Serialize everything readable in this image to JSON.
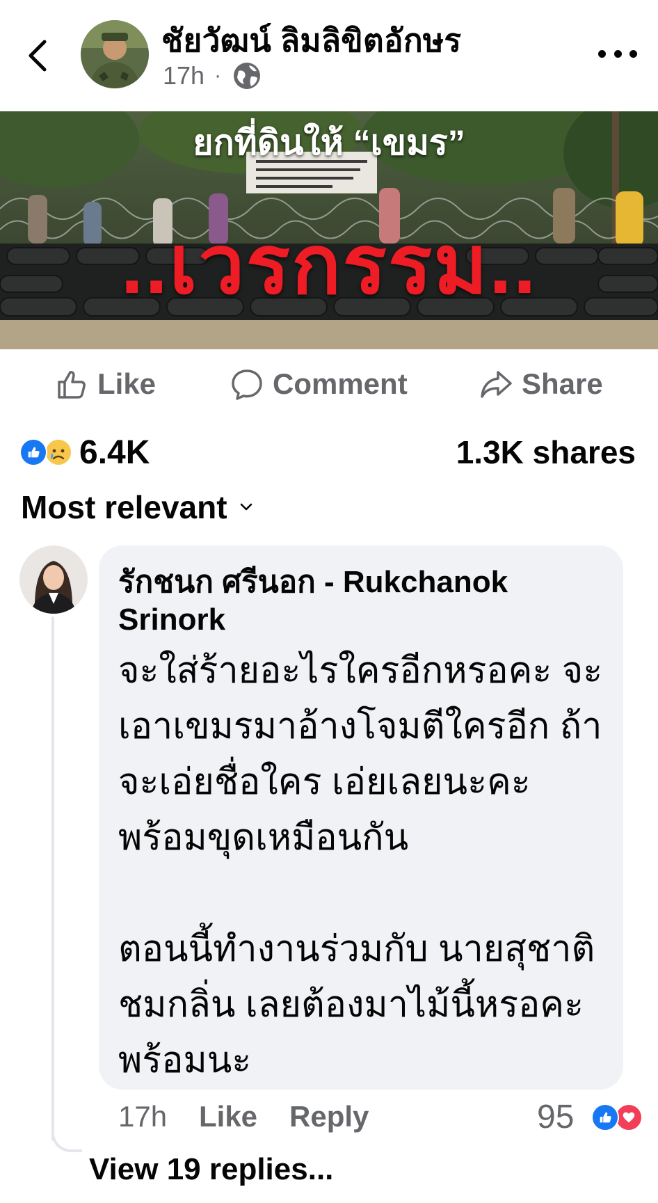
{
  "header": {
    "back_icon": "chevron-left-icon",
    "author_name": "ชัยวัฒน์ ลิมลิขิตอักษร",
    "time": "17h",
    "separator": "·",
    "privacy_icon": "globe-icon",
    "more_icon": "more-horizontal-icon"
  },
  "post_image": {
    "headline_top": "ยกที่ดินให้ “เขมร”",
    "headline_main": "..เวรกรรม..",
    "headline_main_color": "#ee1c24"
  },
  "actions": {
    "like_label": "Like",
    "comment_label": "Comment",
    "share_label": "Share"
  },
  "stats": {
    "reaction_icons": [
      "like-reaction-icon",
      "sad-reaction-icon"
    ],
    "reaction_count": "6.4K",
    "shares": "1.3K shares"
  },
  "sort": {
    "label": "Most relevant"
  },
  "comment": {
    "author": "รักชนก ศรีนอก - Rukchanok Srinork",
    "body": "จะใส่ร้ายอะไรใครอีกหรอคะ จะเอาเขมรมาอ้างโจมตีใครอีก ถ้าจะเอ่ยชื่อใคร เอ่ยเลยนะคะ พร้อมขุดเหมือนกัน\n\nตอนนี้ทำงานร่วมกับ นายสุชาติ ชมกลิ่น เลยต้องมาไม้นี้หรอคะ พร้อมนะ",
    "time": "17h",
    "like_label": "Like",
    "reply_label": "Reply",
    "reaction_count": "95",
    "reaction_icons": [
      "like-reaction-icon",
      "love-reaction-icon"
    ],
    "view_replies": "View 19 replies..."
  },
  "colors": {
    "brand_blue": "#1877f2",
    "secondary_text": "#65676b",
    "bubble_bg": "#f0f2f5",
    "love_red": "#f33e58"
  }
}
